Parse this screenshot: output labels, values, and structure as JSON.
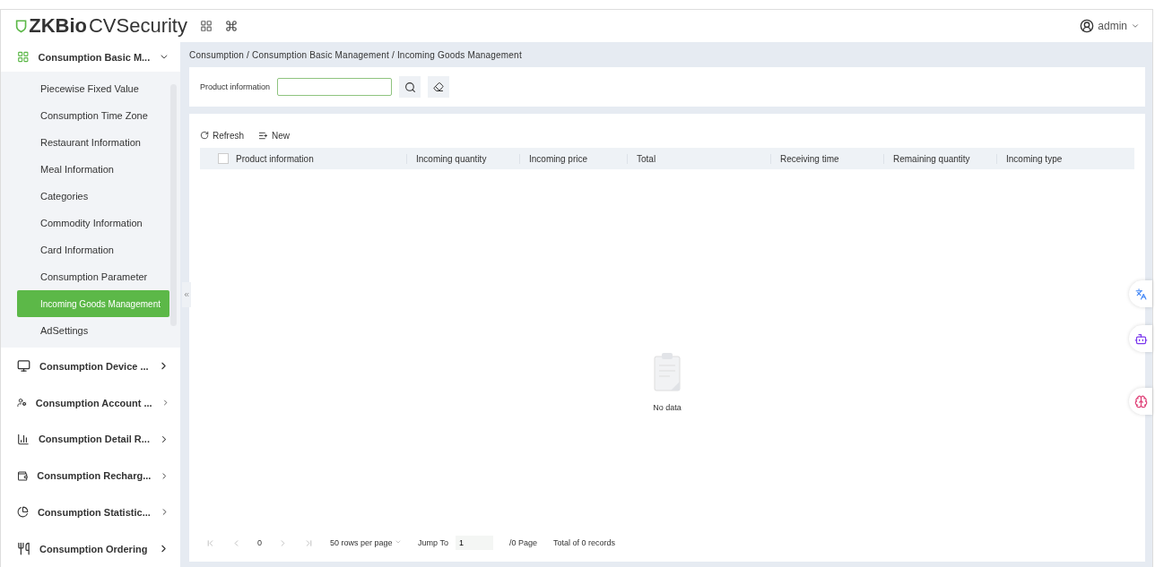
{
  "header": {
    "logo_brand": "ZKBio",
    "logo_product": " CVSecurity",
    "user": "admin"
  },
  "sidebar": {
    "groups": [
      {
        "label": "Consumption Basic M...",
        "expanded": true,
        "children": [
          {
            "label": "Piecewise Fixed Value",
            "selected": false
          },
          {
            "label": "Consumption Time Zone",
            "selected": false
          },
          {
            "label": "Restaurant Information",
            "selected": false
          },
          {
            "label": "Meal Information",
            "selected": false
          },
          {
            "label": "Categories",
            "selected": false
          },
          {
            "label": "Commodity Information",
            "selected": false
          },
          {
            "label": "Card Information",
            "selected": false
          },
          {
            "label": "Consumption Parameter",
            "selected": false
          },
          {
            "label": "Incoming Goods Management",
            "selected": true
          },
          {
            "label": "AdSettings",
            "selected": false
          }
        ]
      },
      {
        "label": "Consumption Device ...",
        "expanded": false
      },
      {
        "label": "Consumption Account ...",
        "expanded": false
      },
      {
        "label": "Consumption Detail R...",
        "expanded": false
      },
      {
        "label": "Consumption Recharg...",
        "expanded": false
      },
      {
        "label": "Consumption Statistic...",
        "expanded": false
      },
      {
        "label": "Consumption Ordering",
        "expanded": false
      }
    ]
  },
  "breadcrumb": "Consumption / Consumption Basic Management / Incoming Goods Management",
  "filter": {
    "label": "Product information"
  },
  "toolbar": [
    "Refresh",
    "New"
  ],
  "table": {
    "select_all_checked": false,
    "columns": [
      "Product information",
      "Incoming quantity",
      "Incoming price",
      "Total",
      "Receiving time",
      "Remaining quantity",
      "Incoming type"
    ],
    "empty_text": "No data"
  },
  "pagination": {
    "page": "0",
    "page_size": "50 rows per page",
    "jump_label": "Jump To",
    "jump_value": "1",
    "pages": "/0 Page",
    "total": "Total of 0 records"
  }
}
